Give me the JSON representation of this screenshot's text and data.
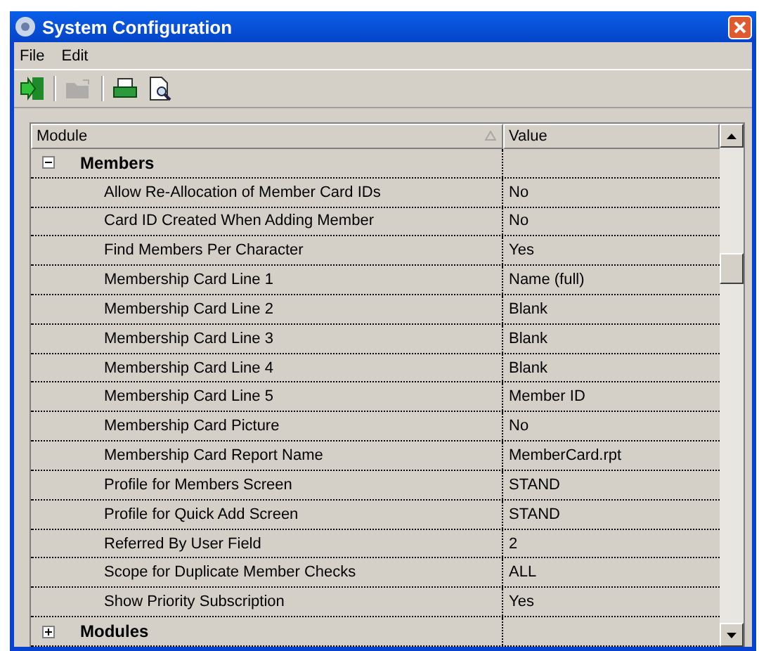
{
  "window": {
    "title": "System Configuration"
  },
  "menu": [
    "File",
    "Edit"
  ],
  "toolbar": [
    {
      "kind": "exit",
      "disabled": false
    },
    {
      "kind": "open",
      "disabled": true
    },
    {
      "kind": "print",
      "disabled": false
    },
    {
      "kind": "preview",
      "disabled": false
    }
  ],
  "grid": {
    "columns": [
      "Module",
      "Value"
    ],
    "groups": [
      {
        "name": "Members",
        "expanded": true,
        "children": [
          {
            "name": "Allow Re-Allocation of Member Card IDs",
            "value": "No"
          },
          {
            "name": "Card ID Created When Adding Member",
            "value": "No"
          },
          {
            "name": "Find Members Per Character",
            "value": "Yes"
          },
          {
            "name": "Membership Card Line 1",
            "value": "Name (full)"
          },
          {
            "name": "Membership Card Line 2",
            "value": "Blank"
          },
          {
            "name": "Membership Card Line 3",
            "value": "Blank"
          },
          {
            "name": "Membership Card Line 4",
            "value": "Blank"
          },
          {
            "name": "Membership Card Line 5",
            "value": "Member ID"
          },
          {
            "name": "Membership Card Picture",
            "value": "No"
          },
          {
            "name": "Membership Card Report Name",
            "value": "MemberCard.rpt"
          },
          {
            "name": "Profile for Members Screen",
            "value": "STAND"
          },
          {
            "name": "Profile for Quick Add Screen",
            "value": "STAND"
          },
          {
            "name": "Referred By User Field",
            "value": "2"
          },
          {
            "name": "Scope for Duplicate Member Checks",
            "value": "ALL"
          },
          {
            "name": "Show Priority Subscription",
            "value": "Yes"
          }
        ]
      },
      {
        "name": "Modules",
        "expanded": false
      }
    ]
  }
}
